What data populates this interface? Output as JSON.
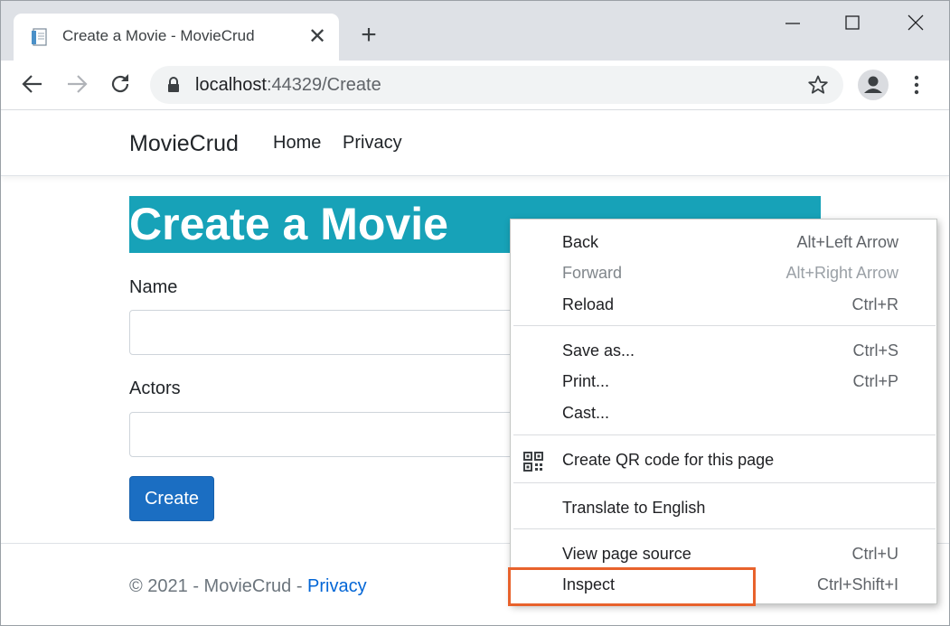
{
  "browser": {
    "tab": {
      "title": "Create a Movie - MovieCrud",
      "close_glyph": "✕",
      "favicon": "page-icon"
    },
    "new_tab_glyph": "+",
    "window_controls": [
      "minimize-icon",
      "maximize-icon",
      "close-icon"
    ],
    "address": {
      "host": "localhost",
      "rest": ":44329/Create"
    },
    "icons": [
      "back-arrow-icon",
      "forward-arrow-icon",
      "reload-icon",
      "lock-icon",
      "star-icon",
      "profile-icon",
      "menu-dots-icon"
    ]
  },
  "site": {
    "brand": "MovieCrud",
    "nav": {
      "home": "Home",
      "privacy": "Privacy"
    },
    "heading": "Create a Movie",
    "form": {
      "name_label": "Name",
      "name_value": "",
      "actors_label": "Actors",
      "actors_value": "",
      "submit_label": "Create"
    },
    "footer": {
      "text": "© 2021 - MovieCrud - ",
      "link": "Privacy"
    },
    "colors": {
      "hero_bg": "#17a2b8",
      "button_bg": "#1b6ec2",
      "link": "#0366d6",
      "highlight": "#e8622c"
    }
  },
  "context_menu": {
    "back": {
      "label": "Back",
      "shortcut": "Alt+Left Arrow"
    },
    "forward": {
      "label": "Forward",
      "shortcut": "Alt+Right Arrow",
      "disabled": true
    },
    "reload": {
      "label": "Reload",
      "shortcut": "Ctrl+R"
    },
    "save_as": {
      "label": "Save as...",
      "shortcut": "Ctrl+S"
    },
    "print": {
      "label": "Print...",
      "shortcut": "Ctrl+P"
    },
    "cast": {
      "label": "Cast...",
      "shortcut": ""
    },
    "qr": {
      "label": "Create QR code for this page",
      "icon": "qr-code-icon"
    },
    "translate": {
      "label": "Translate to English"
    },
    "view_source": {
      "label": "View page source",
      "shortcut": "Ctrl+U"
    },
    "inspect": {
      "label": "Inspect",
      "shortcut": "Ctrl+Shift+I",
      "highlighted": true
    }
  }
}
